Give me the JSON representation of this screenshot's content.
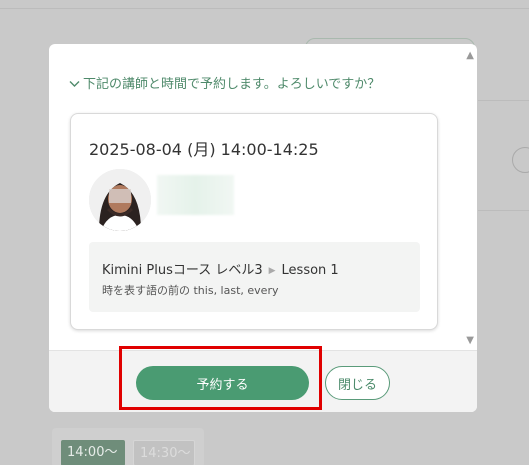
{
  "modal": {
    "confirm_text": "下記の講師と時間で予約します。よろしいですか？",
    "datetime": "2025-08-04 (月) 14:00-14:25",
    "course": {
      "name": "Kimini Plusコース レベル3",
      "lesson": "Lesson 1",
      "topic": "時を表す語の前の this, last, every"
    },
    "reserve_label": "予約する",
    "close_label": "閉じる"
  },
  "background": {
    "slots": [
      "14:00〜",
      "14:30〜"
    ]
  },
  "colors": {
    "accent": "#4a9b72",
    "highlight": "#e00000"
  },
  "icons": {
    "chevron": "chevron-down-icon",
    "scroll_up": "scroll-up-icon",
    "scroll_down": "scroll-down-icon"
  }
}
